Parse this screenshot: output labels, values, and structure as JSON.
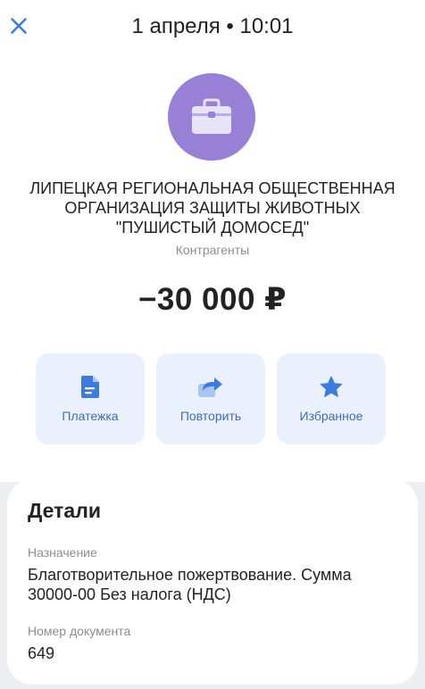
{
  "header": {
    "close_icon": "close-icon",
    "title": "1 апреля • 10:01"
  },
  "payee": {
    "avatar_icon": "briefcase-icon",
    "avatar_color": "#9880d6",
    "name_lines": [
      "ЛИПЕЦКАЯ РЕГИОНАЛЬНАЯ ОБЩЕСТВЕННАЯ",
      "ОРГАНИЗАЦИЯ ЗАЩИТЫ ЖИВОТНЫХ",
      "\"ПУШИСТЫЙ ДОМОСЕД\""
    ],
    "category": "Контрагенты"
  },
  "amount": "−30 000 ₽",
  "actions": [
    {
      "label": "Платежка",
      "icon": "document-icon"
    },
    {
      "label": "Повторить",
      "icon": "repeat-arrow-icon"
    },
    {
      "label": "Избранное",
      "icon": "star-icon"
    }
  ],
  "details": {
    "title": "Детали",
    "purpose_label": "Назначение",
    "purpose_lines": [
      "Благотворительное пожертвование. Сумма",
      "30000-00 Без налога (НДС)"
    ],
    "doc_number_label": "Номер документа",
    "doc_number": "649"
  },
  "colors": {
    "accent": "#3d7be0",
    "action_bg": "#eaf1fc",
    "screen_bg": "#eceef1"
  }
}
